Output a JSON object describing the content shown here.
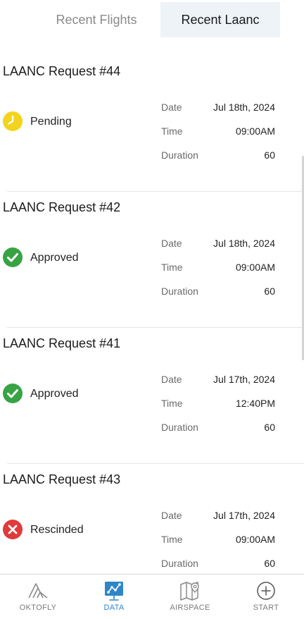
{
  "tabs": {
    "recent_flights": "Recent Flights",
    "recent_laanc": "Recent Laanc"
  },
  "field_labels": {
    "date": "Date",
    "time": "Time",
    "duration": "Duration"
  },
  "requests": [
    {
      "title": "LAANC Request #44",
      "status": "Pending",
      "status_icon": "clock-icon",
      "status_color": "#f2d41e",
      "date": "Jul 18th, 2024",
      "time": "09:00AM",
      "duration": "60"
    },
    {
      "title": "LAANC Request #42",
      "status": "Approved",
      "status_icon": "check-circle-icon",
      "status_color": "#37a345",
      "date": "Jul 18th, 2024",
      "time": "09:00AM",
      "duration": "60"
    },
    {
      "title": "LAANC Request #41",
      "status": "Approved",
      "status_icon": "check-circle-icon",
      "status_color": "#37a345",
      "date": "Jul 17th, 2024",
      "time": "12:40PM",
      "duration": "60"
    },
    {
      "title": "LAANC Request #43",
      "status": "Rescinded",
      "status_icon": "x-circle-icon",
      "status_color": "#e03a3a",
      "date": "Jul 17th, 2024",
      "time": "09:00AM",
      "duration": "60"
    }
  ],
  "bottom_nav": {
    "oktofly": "OKTOFLY",
    "data": "DATA",
    "airspace": "AIRSPACE",
    "start": "START",
    "active_color": "#2e86c9"
  }
}
